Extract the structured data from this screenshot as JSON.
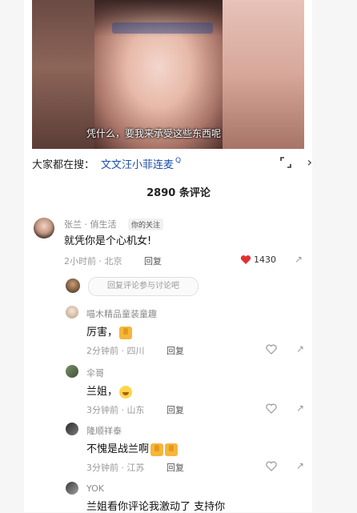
{
  "video": {
    "subtitle": "凭什么，要我来承受这些东西呢"
  },
  "search": {
    "label": "大家都在搜：",
    "term": "文文汪小菲连麦",
    "term_mark": "Q"
  },
  "comments_header": {
    "count_label": "2890 条评论"
  },
  "main_comment": {
    "user": "张兰 · 俏生活",
    "badge": "你的关注",
    "text": "就凭你是个心机女!",
    "time": "2小时前 · 北京",
    "reply": "回复",
    "likes": "1430"
  },
  "reply_prompt": {
    "placeholder": "回复评论参与讨论吧"
  },
  "replies": [
    {
      "user": "喵木精品童装童趣",
      "text": "厉害，",
      "time": "2分钟前 · 四川",
      "reply": "回复"
    },
    {
      "user": "伞哥",
      "text": "兰姐，",
      "time": "3分钟前 · 山东",
      "reply": "回复"
    },
    {
      "user": "隆顺祥泰",
      "text": "不愧是战兰啊",
      "time": "3分钟前 · 江苏",
      "reply": "回复"
    },
    {
      "user": "YOK",
      "text": "兰姐看你评论我激动了 支持你"
    }
  ],
  "icons": {
    "heart_liked_color": "#e3302f",
    "heart_color": "#999999"
  }
}
